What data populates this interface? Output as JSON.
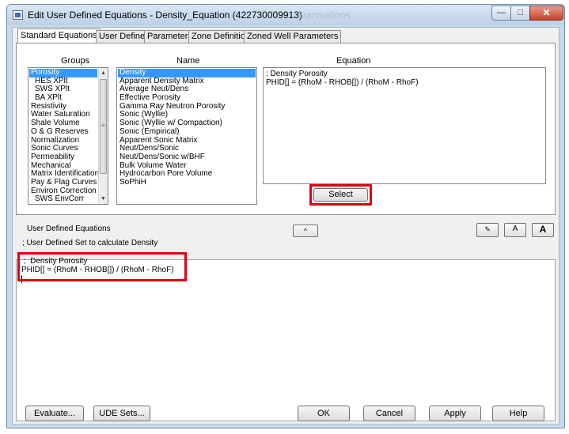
{
  "window": {
    "title": "Edit User Defined Equations - Density_Equation (422730009913)",
    "ghost_title": "Summations",
    "minimize_glyph": "—",
    "maximize_glyph": "□",
    "close_glyph": "✕"
  },
  "tabs": [
    {
      "label": "Standard Equations",
      "active": true
    },
    {
      "label": "User Defined",
      "active": false
    },
    {
      "label": "Parameters",
      "active": false
    },
    {
      "label": "Zone Definition",
      "active": false
    },
    {
      "label": "Zoned Well Parameters",
      "active": false
    }
  ],
  "groups": {
    "header": "Groups",
    "items": [
      {
        "label": "Porosity",
        "selected": true,
        "indent": false
      },
      {
        "label": "HES XPlt",
        "selected": false,
        "indent": true
      },
      {
        "label": "SWS XPlt",
        "selected": false,
        "indent": true
      },
      {
        "label": "BA XPlt",
        "selected": false,
        "indent": true
      },
      {
        "label": "Resistivity",
        "selected": false,
        "indent": false
      },
      {
        "label": "Water Saturation",
        "selected": false,
        "indent": false
      },
      {
        "label": "Shale Volume",
        "selected": false,
        "indent": false
      },
      {
        "label": "O & G Reserves",
        "selected": false,
        "indent": false
      },
      {
        "label": "Normalization",
        "selected": false,
        "indent": false
      },
      {
        "label": "Sonic Curves",
        "selected": false,
        "indent": false
      },
      {
        "label": "Permeability",
        "selected": false,
        "indent": false
      },
      {
        "label": "Mechanical",
        "selected": false,
        "indent": false
      },
      {
        "label": "Matrix Identification",
        "selected": false,
        "indent": false
      },
      {
        "label": "Pay & Flag Curves",
        "selected": false,
        "indent": false
      },
      {
        "label": "Environ Correction",
        "selected": false,
        "indent": false
      },
      {
        "label": "SWS EnvCorr",
        "selected": false,
        "indent": true
      }
    ]
  },
  "names": {
    "header": "Name",
    "items": [
      {
        "label": "Density",
        "selected": true
      },
      {
        "label": "Apparent Density Matrix",
        "selected": false
      },
      {
        "label": "Average Neut/Dens",
        "selected": false
      },
      {
        "label": "Effective Porosity",
        "selected": false
      },
      {
        "label": "Gamma Ray Neutron Porosity",
        "selected": false
      },
      {
        "label": "Sonic (Wyllie)",
        "selected": false
      },
      {
        "label": "Sonic (Wyllie w/ Compaction)",
        "selected": false
      },
      {
        "label": "Sonic (Empirical)",
        "selected": false
      },
      {
        "label": "Apparent Sonic Matrix",
        "selected": false
      },
      {
        "label": "Neut/Dens/Sonic",
        "selected": false
      },
      {
        "label": "Neut/Dens/Sonic w/BHF",
        "selected": false
      },
      {
        "label": "Bulk Volume Water",
        "selected": false
      },
      {
        "label": "Hydrocarbon Pore Volume",
        "selected": false
      },
      {
        "label": "SoPhiH",
        "selected": false
      }
    ]
  },
  "equation": {
    "header": "Equation",
    "lines": [
      "; Density Porosity",
      "PHID[] = (RhoM - RHOB[]) / (RhoM - RhoF)"
    ]
  },
  "select_label": "Select",
  "ude": {
    "label": "User Defined Equations",
    "collapse_glyph": "^",
    "tool1_glyph": "✎",
    "tool2_glyph": "A",
    "tool3_glyph": "A",
    "set_line": "; User Defined Set to calculate Density",
    "editor_lines": [
      " ;  Density Porosity",
      "PHID[] = (RhoM - RHOB[]) / (RhoM - RhoF)"
    ]
  },
  "buttons": {
    "evaluate": "Evaluate...",
    "ude_sets": "UDE Sets...",
    "ok": "OK",
    "cancel": "Cancel",
    "apply": "Apply",
    "help": "Help"
  },
  "colors": {
    "highlight": "#e0000f",
    "selection": "#3399ff"
  }
}
